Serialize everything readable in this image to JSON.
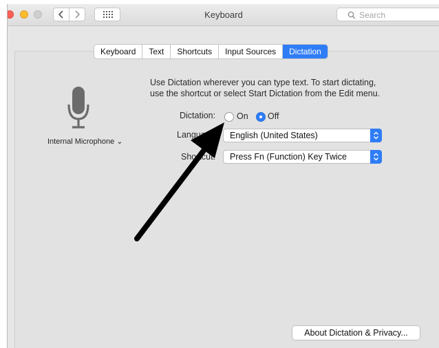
{
  "window": {
    "title": "Keyboard",
    "search_placeholder": "Search"
  },
  "tabs": [
    {
      "label": "Keyboard",
      "active": false
    },
    {
      "label": "Text",
      "active": false
    },
    {
      "label": "Shortcuts",
      "active": false
    },
    {
      "label": "Input Sources",
      "active": false
    },
    {
      "label": "Dictation",
      "active": true
    }
  ],
  "microphone": {
    "icon": "microphone-icon",
    "label": "Internal Microphone ⌄"
  },
  "dictation": {
    "description_line1": "Use Dictation wherever you can type text. To start dictating,",
    "description_line2": "use the shortcut or select Start Dictation from the Edit menu.",
    "label": "Dictation:",
    "on_label": "On",
    "off_label": "Off",
    "selected": "Off",
    "language_label": "Language:",
    "language_value": "English (United States)",
    "shortcut_label": "Shortcut:",
    "shortcut_value": "Press Fn (Function) Key Twice"
  },
  "about_button": "About Dictation & Privacy...",
  "colors": {
    "accent": "#2f7df6",
    "close": "#fd5f57",
    "minimize": "#fdbc2e"
  }
}
